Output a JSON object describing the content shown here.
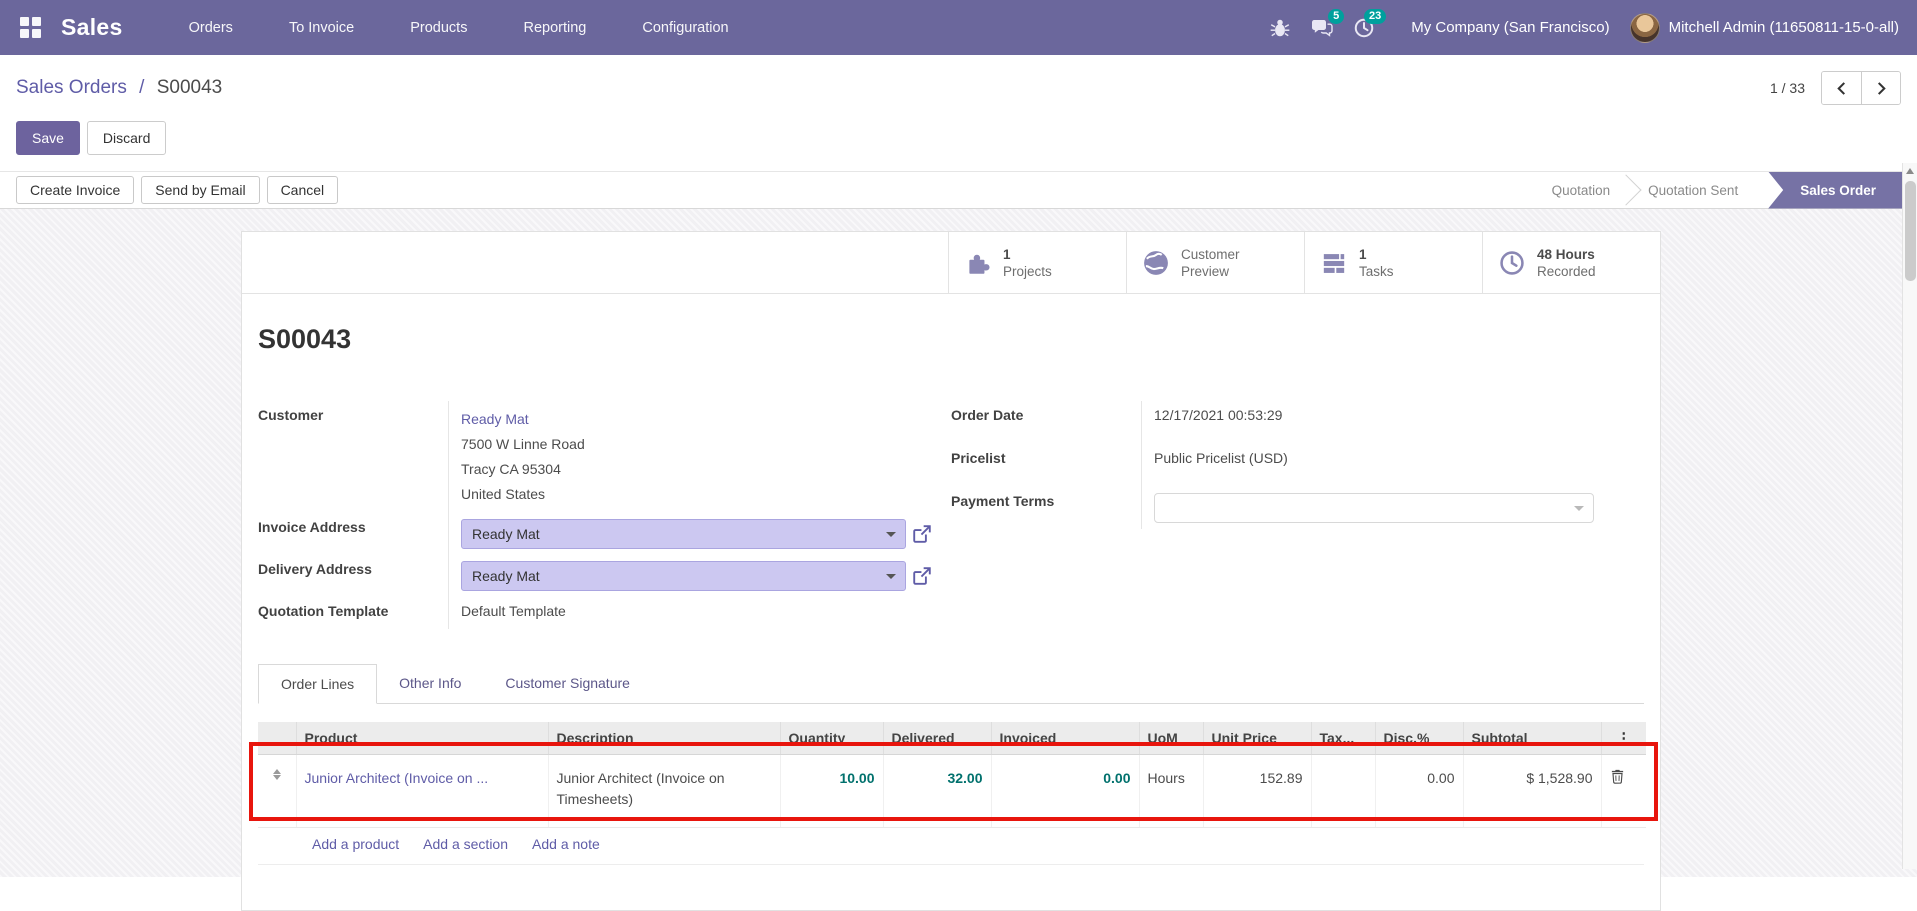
{
  "navbar": {
    "app_name": "Sales",
    "menus": [
      "Orders",
      "To Invoice",
      "Products",
      "Reporting",
      "Configuration"
    ],
    "messages_badge": "5",
    "activities_badge": "23",
    "company": "My Company (San Francisco)",
    "user": "Mitchell Admin (11650811-15-0-all)"
  },
  "control_panel": {
    "breadcrumb_parent": "Sales Orders",
    "breadcrumb_separator": "/",
    "breadcrumb_current": "S00043",
    "save": "Save",
    "discard": "Discard",
    "pager": "1 / 33"
  },
  "action_bar": {
    "create_invoice": "Create Invoice",
    "send_by_email": "Send by Email",
    "cancel": "Cancel",
    "statuses": [
      "Quotation",
      "Quotation Sent",
      "Sales Order"
    ],
    "active_status": "Sales Order"
  },
  "stat_buttons": [
    {
      "value": "1",
      "label": "Projects",
      "icon": "puzzle-icon"
    },
    {
      "value": "Customer",
      "label": "Preview",
      "icon": "globe-icon"
    },
    {
      "value": "1",
      "label": "Tasks",
      "icon": "tasks-icon"
    },
    {
      "value": "48 Hours",
      "label": "Recorded",
      "icon": "clock-icon"
    }
  ],
  "form": {
    "title": "S00043",
    "customer_label": "Customer",
    "customer_name": "Ready Mat",
    "customer_address_line1": "7500 W Linne Road",
    "customer_address_line2": "Tracy CA 95304",
    "customer_address_line3": "United States",
    "invoice_address_label": "Invoice Address",
    "invoice_address_value": "Ready Mat",
    "delivery_address_label": "Delivery Address",
    "delivery_address_value": "Ready Mat",
    "quotation_template_label": "Quotation Template",
    "quotation_template_value": "Default Template",
    "order_date_label": "Order Date",
    "order_date_value": "12/17/2021 00:53:29",
    "pricelist_label": "Pricelist",
    "pricelist_value": "Public Pricelist (USD)",
    "payment_terms_label": "Payment Terms",
    "payment_terms_value": ""
  },
  "tabs": {
    "order_lines": "Order Lines",
    "other_info": "Other Info",
    "customer_signature": "Customer Signature"
  },
  "table": {
    "headers": {
      "product": "Product",
      "description": "Description",
      "quantity": "Quantity",
      "delivered": "Delivered",
      "invoiced": "Invoiced",
      "uom": "UoM",
      "unit_price": "Unit Price",
      "tax": "Tax...",
      "disc": "Disc.%",
      "subtotal": "Subtotal"
    },
    "row": {
      "product": "Junior Architect (Invoice on ...",
      "description": "Junior Architect (Invoice on Timesheets)",
      "quantity": "10.00",
      "delivered": "32.00",
      "invoiced": "0.00",
      "uom": "Hours",
      "unit_price": "152.89",
      "tax": "",
      "disc": "0.00",
      "subtotal": "$ 1,528.90"
    },
    "links": {
      "add_product": "Add a product",
      "add_section": "Add a section",
      "add_note": "Add a note"
    }
  },
  "colors": {
    "navbar_bg": "#6b679c",
    "primary_button": "#6d639e",
    "badge_teal": "#00a09d",
    "link_purple": "#5f5ca7",
    "status_active_bg": "#7672a5",
    "field_highlight_bg": "#ccc8f1",
    "teal_number": "#01716d",
    "annotation_red": "#e8150d"
  }
}
